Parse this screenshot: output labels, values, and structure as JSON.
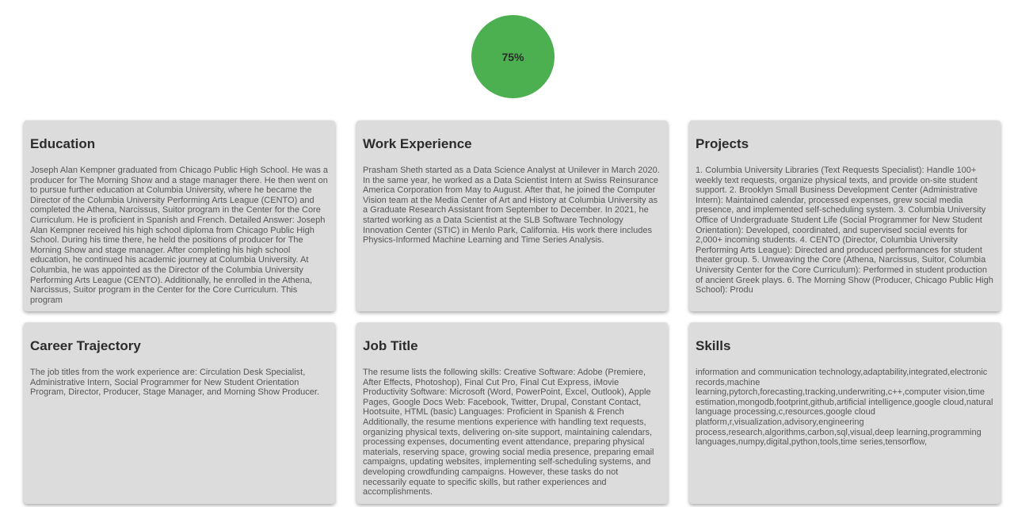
{
  "progress": {
    "label": "75%",
    "value": 0.75,
    "color": "#4caf50"
  },
  "cards": [
    {
      "title": "Education",
      "text": "Joseph Alan Kempner graduated from Chicago Public High School. He was a producer for The Morning Show and a stage manager there. He then went on to pursue further education at Columbia University, where he became the Director of the Columbia University Performing Arts League (CENTO) and completed the Athena, Narcissus, Suitor program in the Center for the Core Curriculum. He is proficient in Spanish and French. Detailed Answer: Joseph Alan Kempner received his high school diploma from Chicago Public High School. During his time there, he held the positions of producer for The Morning Show and stage manager. After completing his high school education, he continued his academic journey at Columbia University. At Columbia, he was appointed as the Director of the Columbia University Performing Arts League (CENTO). Additionally, he enrolled in the Athena, Narcissus, Suitor program in the Center for the Core Curriculum. This program"
    },
    {
      "title": "Work Experience",
      "text": "Prasham Sheth started as a Data Science Analyst at Unilever in March 2020. In the same year, he worked as a Data Scientist Intern at Swiss Reinsurance America Corporation from May to August. After that, he joined the Computer Vision team at the Media Center of Art and History at Columbia University as a Graduate Research Assistant from September to December. In 2021, he started working as a Data Scientist at the SLB Software Technology Innovation Center (STIC) in Menlo Park, California. His work there includes Physics-Informed Machine Learning and Time Series Analysis."
    },
    {
      "title": "Projects",
      "text": "1. Columbia University Libraries (Text Requests Specialist): Handle 100+ weekly text requests, organize physical texts, and provide on-site student support. 2. Brooklyn Small Business Development Center (Administrative Intern): Maintained calendar, processed expenses, grew social media presence, and implemented self-scheduling system. 3. Columbia University Office of Undergraduate Student Life (Social Programmer for New Student Orientation): Developed, coordinated, and supervised social events for 2,000+ incoming students. 4. CENTO (Director, Columbia University Performing Arts League): Directed and produced performances for student theater group. 5. Unweaving the Core (Athena, Narcissus, Suitor, Columbia University Center for the Core Curriculum): Performed in student production of ancient Greek plays. 6. The Morning Show (Producer, Chicago Public High School): Produ"
    },
    {
      "title": "Career Trajectory",
      "text": "The job titles from the work experience are: Circulation Desk Specialist, Administrative Intern, Social Programmer for New Student Orientation Program, Director, Producer, Stage Manager, and Morning Show Producer."
    },
    {
      "title": "Job Title",
      "text": "The resume lists the following skills: Creative Software: Adobe (Premiere, After Effects, Photoshop), Final Cut Pro, Final Cut Express, iMovie Productivity Software: Microsoft (Word, PowerPoint, Excel, Outlook), Apple Pages, Google Docs Web: Facebook, Twitter, Drupal, Constant Contact, Hootsuite, HTML (basic) Languages: Proficient in Spanish & French Additionally, the resume mentions experience with handling text requests, organizing physical texts, delivering on-site support, maintaining calendars, processing expenses, documenting event attendance, preparing physical materials, reserving space, growing social media presence, preparing email campaigns, updating websites, implementing self-scheduling systems, and developing crowdfunding campaigns. However, these tasks do not necessarily equate to specific skills, but rather experiences and accomplishments."
    },
    {
      "title": "Skills",
      "text": "information and communication technology,adaptability,integrated,electronic records,machine learning,pytorch,forecasting,tracking,underwriting,c++,computer vision,time estimation,mongodb,footprint,github,artificial intelligence,google cloud,natural language processing,c,resources,google cloud platform,r,visualization,advisory,engineering process,research,algorithms,carbon,sql,visual,deep learning,programming languages,numpy,digital,python,tools,time series,tensorflow,"
    }
  ]
}
